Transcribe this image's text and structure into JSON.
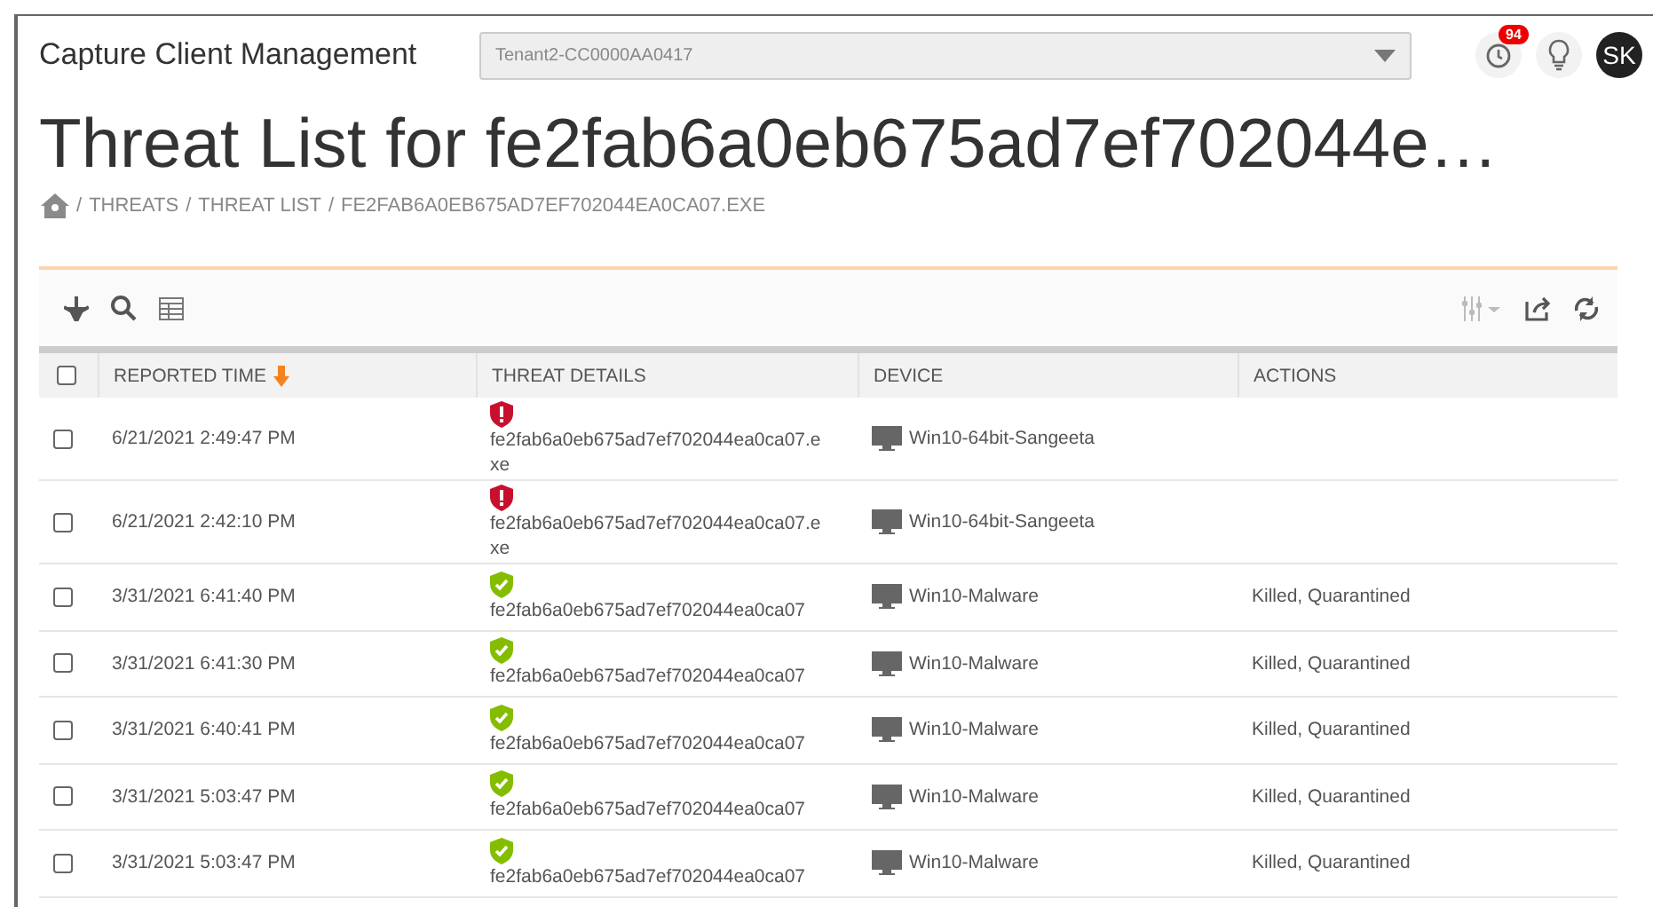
{
  "header": {
    "app_title": "Capture Client Management",
    "tenant_select": "Tenant2-CC0000AA0417",
    "notifications_badge": "94",
    "avatar": "SK"
  },
  "page_title": "Threat List for fe2fab6a0eb675ad7ef702044e…",
  "breadcrumb_separator": "/",
  "breadcrumb": [
    "THREATS",
    "THREAT LIST",
    "FE2FAB6A0EB675AD7EF702044EA0CA07.EXE"
  ],
  "table": {
    "select_all_checked": false,
    "columns": [
      "REPORTED TIME",
      "THREAT DETAILS",
      "DEVICE",
      "ACTIONS"
    ],
    "rows": [
      {
        "checked": false,
        "time": "6/21/2021 2:49:47 PM",
        "kind": "active",
        "threat": "fe2fab6a0eb675ad7ef702044ea0ca07.exe",
        "device": "Win10-64bit-Sangeeta"
      },
      {
        "checked": false,
        "time": "6/21/2021 2:42:10 PM",
        "kind": "active",
        "threat": "fe2fab6a0eb675ad7ef702044ea0ca07.exe",
        "device": "Win10-64bit-Sangeeta"
      },
      {
        "checked": false,
        "time": "3/31/2021 6:41:40 PM",
        "kind": "resolved",
        "threat": "fe2fab6a0eb675ad7ef702044ea0ca07",
        "device": "Win10-Malware",
        "actions": "Killed, Quarantined"
      },
      {
        "checked": false,
        "time": "3/31/2021 6:41:30 PM",
        "kind": "resolved",
        "threat": "fe2fab6a0eb675ad7ef702044ea0ca07",
        "device": "Win10-Malware",
        "actions": "Killed, Quarantined"
      },
      {
        "checked": false,
        "time": "3/31/2021 6:40:41 PM",
        "kind": "resolved",
        "threat": "fe2fab6a0eb675ad7ef702044ea0ca07",
        "device": "Win10-Malware",
        "actions": "Killed, Quarantined"
      },
      {
        "checked": false,
        "time": "3/31/2021 5:03:47 PM",
        "kind": "resolved",
        "threat": "fe2fab6a0eb675ad7ef702044ea0ca07",
        "device": "Win10-Malware",
        "actions": "Killed, Quarantined"
      },
      {
        "checked": false,
        "time": "3/31/2021 5:03:47 PM",
        "kind": "resolved",
        "threat": "fe2fab6a0eb675ad7ef702044ea0ca07",
        "device": "Win10-Malware",
        "actions": "Killed, Quarantined"
      }
    ]
  }
}
